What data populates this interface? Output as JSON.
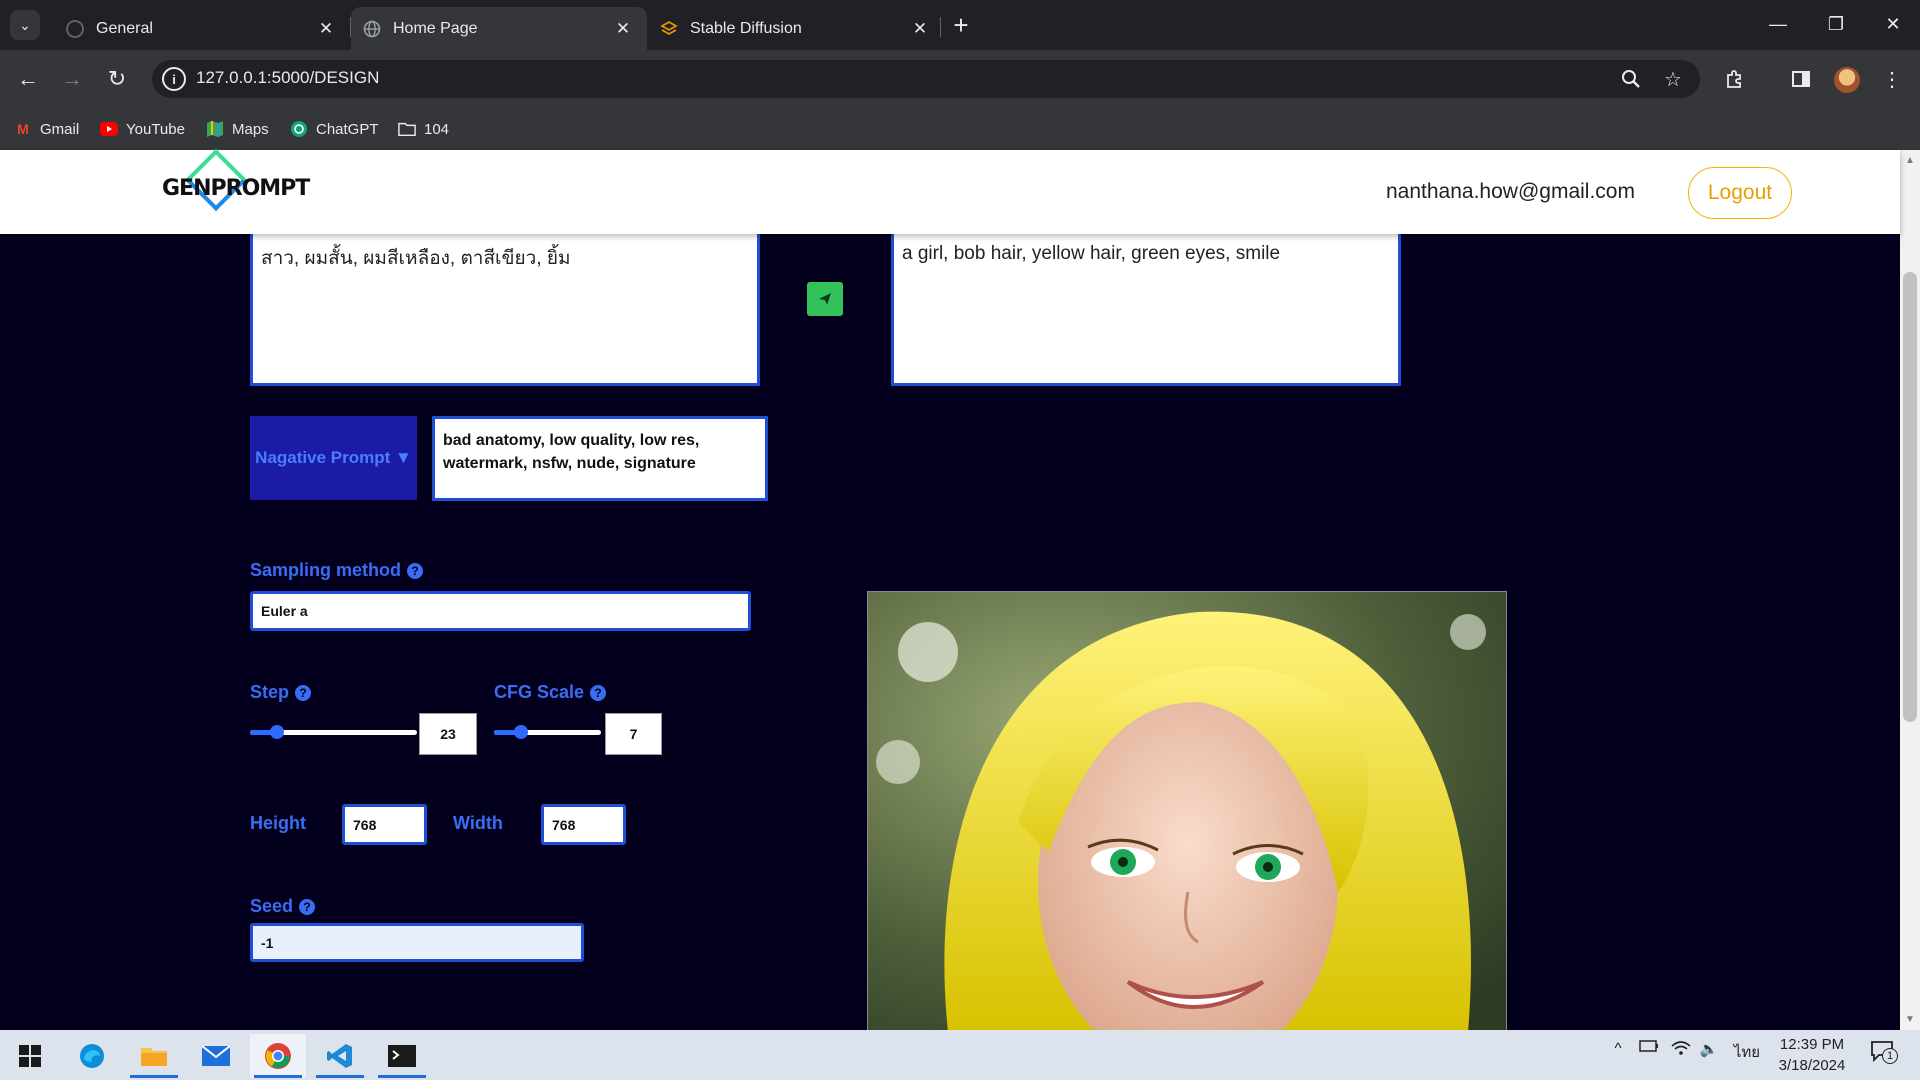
{
  "browser": {
    "tabs": [
      {
        "title": "General",
        "favicon": "github-icon",
        "active": false
      },
      {
        "title": "Home Page",
        "favicon": "globe-icon",
        "active": true
      },
      {
        "title": "Stable Diffusion",
        "favicon": "stable-diffusion-icon",
        "active": false
      }
    ],
    "url": "127.0.0.1:5000/DESIGN",
    "bookmarks": [
      {
        "label": "Gmail",
        "icon": "gmail-icon"
      },
      {
        "label": "YouTube",
        "icon": "youtube-icon"
      },
      {
        "label": "Maps",
        "icon": "maps-icon"
      },
      {
        "label": "ChatGPT",
        "icon": "chatgpt-icon"
      },
      {
        "label": "104",
        "icon": "folder-icon"
      }
    ]
  },
  "header": {
    "logo_text": "GENPROMPT",
    "user_email": "nanthana.how@gmail.com",
    "logout_label": "Logout"
  },
  "prompt": {
    "thai_text": "สาว, ผมสั้น, ผมสีเหลือง, ตาสีเขียว, ยิ้ม",
    "english_text": "a girl, bob hair, yellow hair, green eyes, smile"
  },
  "negative_prompt": {
    "label": "Nagative Prompt ▼",
    "text": "bad anatomy, low quality, low res, watermark, nsfw, nude, signature"
  },
  "settings": {
    "sampling_method_label": "Sampling method",
    "sampling_method_value": "Euler a",
    "step_label": "Step",
    "step_value": "23",
    "step_fraction": 0.16,
    "cfg_label": "CFG Scale",
    "cfg_value": "7",
    "cfg_fraction": 0.25,
    "height_label": "Height",
    "height_value": "768",
    "width_label": "Width",
    "width_value": "768",
    "seed_label": "Seed",
    "seed_value": "-1"
  },
  "taskbar": {
    "time": "12:39 PM",
    "date": "3/18/2024",
    "language": "ไทย",
    "notification_count": "1"
  },
  "colors": {
    "page_background": "#03001e",
    "accent_blue": "#3a6cf4",
    "send_green": "#33c25a",
    "logout_yellow": "#f4b400"
  }
}
